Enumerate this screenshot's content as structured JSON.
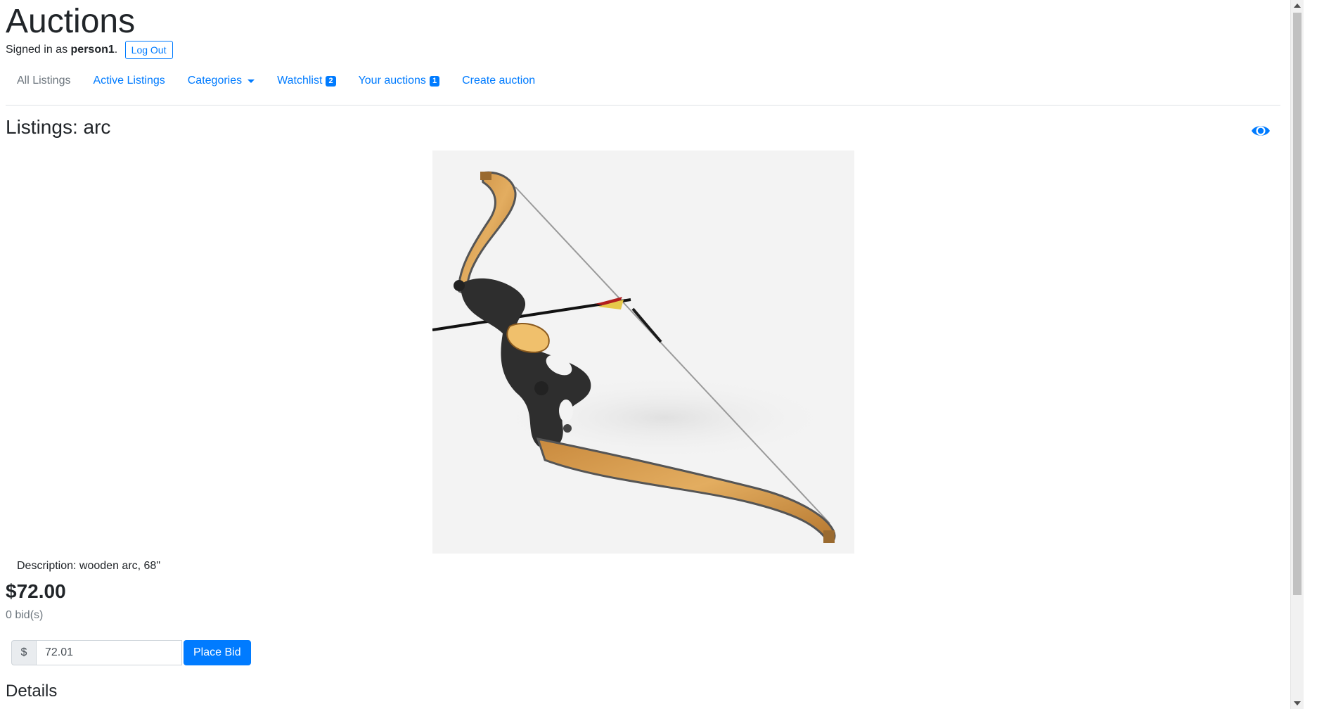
{
  "header": {
    "title": "Auctions",
    "signed_in_prefix": "Signed in as ",
    "username": "person1",
    "signed_in_suffix": ".",
    "logout_label": "Log Out"
  },
  "nav": {
    "all_listings": "All Listings",
    "active_listings": "Active Listings",
    "categories": "Categories",
    "watchlist": "Watchlist",
    "watchlist_count": "2",
    "your_auctions": "Your auctions",
    "your_auctions_count": "1",
    "create_auction": "Create auction"
  },
  "listing": {
    "title": "Listings: arc",
    "description": "Description: wooden arc, 68\"",
    "price": "$72.00",
    "bids": "0 bid(s)",
    "image_icon": "bow-and-arrow-image"
  },
  "bid_form": {
    "currency": "$",
    "value": "72.01",
    "submit_label": "Place Bid"
  },
  "details_heading": "Details",
  "icons": {
    "watch": "eye-icon"
  },
  "colors": {
    "primary": "#007bff",
    "muted": "#6c757d"
  }
}
